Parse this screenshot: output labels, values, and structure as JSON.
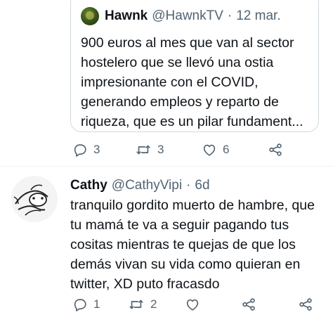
{
  "quoted_tweet": {
    "display_name": "Hawnk",
    "handle": "@HawnkTV",
    "separator": "·",
    "date": "12 mar.",
    "text": "900 euros al mes que van al sector\nhostelero que se llevó una ostia\nimpresionante con el COVID,\ngenerando empleos y reparto de\nriqueza, que es un pilar fundament..."
  },
  "main_actions": {
    "reply_count": "3",
    "retweet_count": "3",
    "like_count": "6"
  },
  "reply_tweet": {
    "display_name": "Cathy",
    "handle": "@CathyVipi",
    "separator": "·",
    "date": "6d",
    "text": "tranquilo gordito muerto de hambre, que\ntu mamá te va a seguir pagando tus\ncositas mientras te quejas de que los\ndemás vivan su vida como quieran en\ntwitter, XD puto fracasdo"
  },
  "reply_actions": {
    "reply_count": "1",
    "retweet_count": "2",
    "like_count": ""
  },
  "icons": {
    "reply": "reply-icon",
    "retweet": "retweet-icon",
    "like": "heart-icon",
    "share": "share-icon"
  },
  "colors": {
    "text": "#0f1419",
    "secondary": "#536471",
    "border": "#cfd9de"
  }
}
